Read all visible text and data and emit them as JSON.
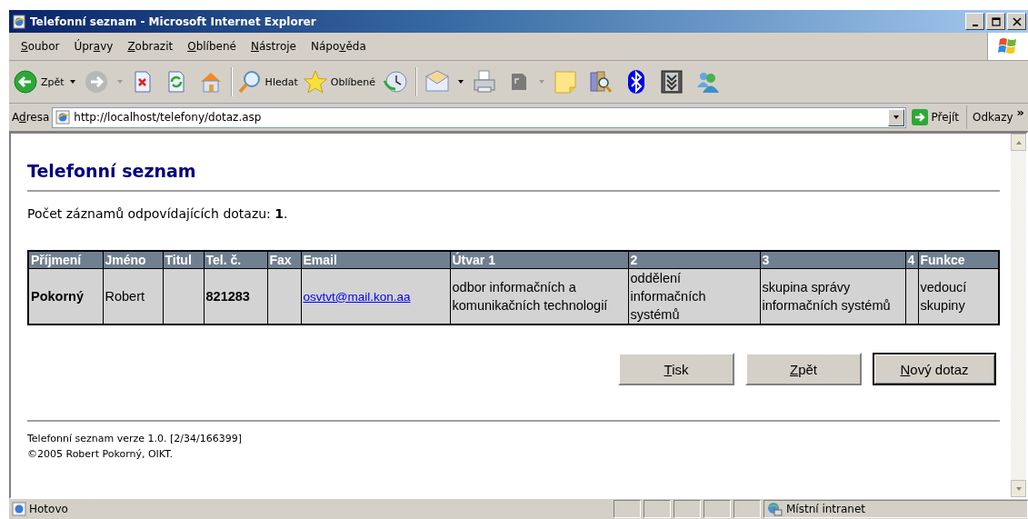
{
  "window": {
    "title": "Telefonní seznam - Microsoft Internet Explorer"
  },
  "menu": [
    {
      "key": "S",
      "post": "oubor"
    },
    {
      "pre": "Úpr",
      "key": "a",
      "post": "vy"
    },
    {
      "key": "Z",
      "post": "obrazit"
    },
    {
      "key": "O",
      "post": "blíbené"
    },
    {
      "key": "N",
      "post": "ástroje"
    },
    {
      "pre": "Nápo",
      "key": "v",
      "post": "ěda"
    }
  ],
  "toolbar": {
    "back_label": "Zpět",
    "forward_disabled": true,
    "search_label": "Hledat",
    "favorites_label": "Oblíbené"
  },
  "address": {
    "pre": "A",
    "key": "d",
    "post": "resa",
    "url": "http://localhost/telefony/dotaz.asp",
    "go": "Přejít",
    "links": "Odkazy",
    "more": "»"
  },
  "page": {
    "heading": "Telefonní seznam",
    "count": "Počet záznamů odpovídajících dotazu: **1**.",
    "table": {
      "columns": [
        "Příjmení",
        "Jméno",
        "Titul",
        "Tel. č.",
        "Fax",
        "Email",
        "Útvar 1",
        "2",
        "3",
        "4",
        "Funkce"
      ],
      "rows": [
        {
          "cells": [
            {
              "kind": "bold",
              "text": "Pokorný"
            },
            {
              "kind": "plain",
              "text": "Robert"
            },
            {
              "kind": "empty"
            },
            {
              "kind": "bold",
              "text": "821283"
            },
            {
              "kind": "empty"
            },
            {
              "kind": "link",
              "text": "osvtvt@mail.kon.aa"
            },
            {
              "kind": "plain",
              "text": "odbor informačních a komunikačních technologií"
            },
            {
              "kind": "plain",
              "text": "oddělení informačních systémů"
            },
            {
              "kind": "plain",
              "text": "skupina správy informačních systémů"
            },
            {
              "kind": "empty"
            },
            {
              "kind": "plain",
              "text": "vedoucí skupiny"
            }
          ]
        }
      ]
    },
    "buttons": [
      {
        "key": "T",
        "post": "isk",
        "default": false
      },
      {
        "key": "Z",
        "post": "pět",
        "default": false
      },
      {
        "key": "N",
        "post": "ový dotaz",
        "default": true
      }
    ],
    "footer": [
      "Telefonní seznam verze 1.0. [2/34/166399]",
      "©2005 Robert Pokorný, OIKT."
    ]
  },
  "status": {
    "text": "Hotovo",
    "zone": "Místní intranet"
  }
}
